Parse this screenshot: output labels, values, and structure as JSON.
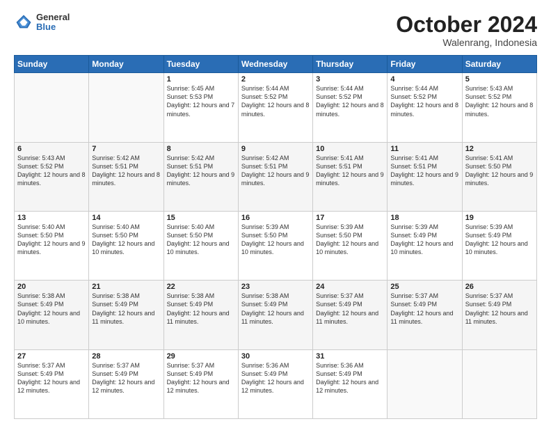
{
  "header": {
    "logo_general": "General",
    "logo_blue": "Blue",
    "month_year": "October 2024",
    "location": "Walenrang, Indonesia"
  },
  "days_of_week": [
    "Sunday",
    "Monday",
    "Tuesday",
    "Wednesday",
    "Thursday",
    "Friday",
    "Saturday"
  ],
  "weeks": [
    [
      {
        "day": "",
        "sunrise": "",
        "sunset": "",
        "daylight": "",
        "empty": true
      },
      {
        "day": "",
        "sunrise": "",
        "sunset": "",
        "daylight": "",
        "empty": true
      },
      {
        "day": "1",
        "sunrise": "Sunrise: 5:45 AM",
        "sunset": "Sunset: 5:53 PM",
        "daylight": "Daylight: 12 hours and 7 minutes."
      },
      {
        "day": "2",
        "sunrise": "Sunrise: 5:44 AM",
        "sunset": "Sunset: 5:52 PM",
        "daylight": "Daylight: 12 hours and 8 minutes."
      },
      {
        "day": "3",
        "sunrise": "Sunrise: 5:44 AM",
        "sunset": "Sunset: 5:52 PM",
        "daylight": "Daylight: 12 hours and 8 minutes."
      },
      {
        "day": "4",
        "sunrise": "Sunrise: 5:44 AM",
        "sunset": "Sunset: 5:52 PM",
        "daylight": "Daylight: 12 hours and 8 minutes."
      },
      {
        "day": "5",
        "sunrise": "Sunrise: 5:43 AM",
        "sunset": "Sunset: 5:52 PM",
        "daylight": "Daylight: 12 hours and 8 minutes."
      }
    ],
    [
      {
        "day": "6",
        "sunrise": "Sunrise: 5:43 AM",
        "sunset": "Sunset: 5:52 PM",
        "daylight": "Daylight: 12 hours and 8 minutes."
      },
      {
        "day": "7",
        "sunrise": "Sunrise: 5:42 AM",
        "sunset": "Sunset: 5:51 PM",
        "daylight": "Daylight: 12 hours and 8 minutes."
      },
      {
        "day": "8",
        "sunrise": "Sunrise: 5:42 AM",
        "sunset": "Sunset: 5:51 PM",
        "daylight": "Daylight: 12 hours and 9 minutes."
      },
      {
        "day": "9",
        "sunrise": "Sunrise: 5:42 AM",
        "sunset": "Sunset: 5:51 PM",
        "daylight": "Daylight: 12 hours and 9 minutes."
      },
      {
        "day": "10",
        "sunrise": "Sunrise: 5:41 AM",
        "sunset": "Sunset: 5:51 PM",
        "daylight": "Daylight: 12 hours and 9 minutes."
      },
      {
        "day": "11",
        "sunrise": "Sunrise: 5:41 AM",
        "sunset": "Sunset: 5:51 PM",
        "daylight": "Daylight: 12 hours and 9 minutes."
      },
      {
        "day": "12",
        "sunrise": "Sunrise: 5:41 AM",
        "sunset": "Sunset: 5:50 PM",
        "daylight": "Daylight: 12 hours and 9 minutes."
      }
    ],
    [
      {
        "day": "13",
        "sunrise": "Sunrise: 5:40 AM",
        "sunset": "Sunset: 5:50 PM",
        "daylight": "Daylight: 12 hours and 9 minutes."
      },
      {
        "day": "14",
        "sunrise": "Sunrise: 5:40 AM",
        "sunset": "Sunset: 5:50 PM",
        "daylight": "Daylight: 12 hours and 10 minutes."
      },
      {
        "day": "15",
        "sunrise": "Sunrise: 5:40 AM",
        "sunset": "Sunset: 5:50 PM",
        "daylight": "Daylight: 12 hours and 10 minutes."
      },
      {
        "day": "16",
        "sunrise": "Sunrise: 5:39 AM",
        "sunset": "Sunset: 5:50 PM",
        "daylight": "Daylight: 12 hours and 10 minutes."
      },
      {
        "day": "17",
        "sunrise": "Sunrise: 5:39 AM",
        "sunset": "Sunset: 5:50 PM",
        "daylight": "Daylight: 12 hours and 10 minutes."
      },
      {
        "day": "18",
        "sunrise": "Sunrise: 5:39 AM",
        "sunset": "Sunset: 5:49 PM",
        "daylight": "Daylight: 12 hours and 10 minutes."
      },
      {
        "day": "19",
        "sunrise": "Sunrise: 5:39 AM",
        "sunset": "Sunset: 5:49 PM",
        "daylight": "Daylight: 12 hours and 10 minutes."
      }
    ],
    [
      {
        "day": "20",
        "sunrise": "Sunrise: 5:38 AM",
        "sunset": "Sunset: 5:49 PM",
        "daylight": "Daylight: 12 hours and 10 minutes."
      },
      {
        "day": "21",
        "sunrise": "Sunrise: 5:38 AM",
        "sunset": "Sunset: 5:49 PM",
        "daylight": "Daylight: 12 hours and 11 minutes."
      },
      {
        "day": "22",
        "sunrise": "Sunrise: 5:38 AM",
        "sunset": "Sunset: 5:49 PM",
        "daylight": "Daylight: 12 hours and 11 minutes."
      },
      {
        "day": "23",
        "sunrise": "Sunrise: 5:38 AM",
        "sunset": "Sunset: 5:49 PM",
        "daylight": "Daylight: 12 hours and 11 minutes."
      },
      {
        "day": "24",
        "sunrise": "Sunrise: 5:37 AM",
        "sunset": "Sunset: 5:49 PM",
        "daylight": "Daylight: 12 hours and 11 minutes."
      },
      {
        "day": "25",
        "sunrise": "Sunrise: 5:37 AM",
        "sunset": "Sunset: 5:49 PM",
        "daylight": "Daylight: 12 hours and 11 minutes."
      },
      {
        "day": "26",
        "sunrise": "Sunrise: 5:37 AM",
        "sunset": "Sunset: 5:49 PM",
        "daylight": "Daylight: 12 hours and 11 minutes."
      }
    ],
    [
      {
        "day": "27",
        "sunrise": "Sunrise: 5:37 AM",
        "sunset": "Sunset: 5:49 PM",
        "daylight": "Daylight: 12 hours and 12 minutes."
      },
      {
        "day": "28",
        "sunrise": "Sunrise: 5:37 AM",
        "sunset": "Sunset: 5:49 PM",
        "daylight": "Daylight: 12 hours and 12 minutes."
      },
      {
        "day": "29",
        "sunrise": "Sunrise: 5:37 AM",
        "sunset": "Sunset: 5:49 PM",
        "daylight": "Daylight: 12 hours and 12 minutes."
      },
      {
        "day": "30",
        "sunrise": "Sunrise: 5:36 AM",
        "sunset": "Sunset: 5:49 PM",
        "daylight": "Daylight: 12 hours and 12 minutes."
      },
      {
        "day": "31",
        "sunrise": "Sunrise: 5:36 AM",
        "sunset": "Sunset: 5:49 PM",
        "daylight": "Daylight: 12 hours and 12 minutes."
      },
      {
        "day": "",
        "sunrise": "",
        "sunset": "",
        "daylight": "",
        "empty": true
      },
      {
        "day": "",
        "sunrise": "",
        "sunset": "",
        "daylight": "",
        "empty": true
      }
    ]
  ]
}
